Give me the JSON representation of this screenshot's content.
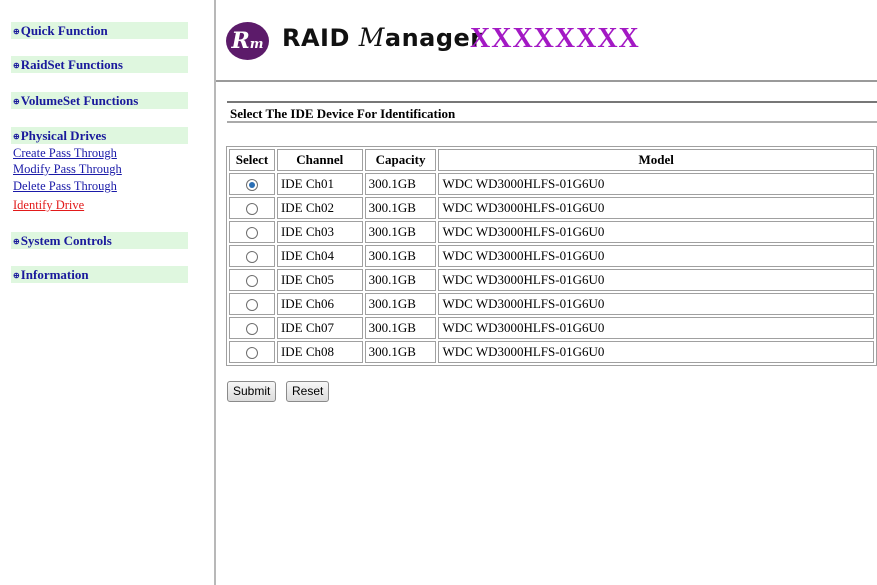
{
  "sidebar": {
    "sections": [
      {
        "label": "Quick Function"
      },
      {
        "label": "RaidSet Functions"
      },
      {
        "label": "VolumeSet Functions"
      },
      {
        "label": "Physical Drives"
      },
      {
        "label": "System Controls"
      },
      {
        "label": "Information"
      }
    ],
    "bullet": "⊕",
    "physical_links": [
      {
        "label": "Create Pass Through",
        "active": false
      },
      {
        "label": "Modify Pass Through",
        "active": false
      },
      {
        "label": "Delete Pass Through",
        "active": false
      },
      {
        "label": "Identify Drive",
        "active": true
      }
    ]
  },
  "header": {
    "logo_letters": "R",
    "logo_sub": "m",
    "logo_text_1": "RAID ",
    "logo_text_m": "M",
    "logo_text_2": "anager",
    "brand": "XXXXXXXX"
  },
  "main": {
    "section_title": "Select The IDE Device For Identification",
    "columns": [
      "Select",
      "Channel",
      "Capacity",
      "Model"
    ],
    "rows": [
      {
        "selected": true,
        "channel": "IDE Ch01",
        "capacity": "300.1GB",
        "model": "WDC WD3000HLFS-01G6U0"
      },
      {
        "selected": false,
        "channel": "IDE Ch02",
        "capacity": "300.1GB",
        "model": "WDC WD3000HLFS-01G6U0"
      },
      {
        "selected": false,
        "channel": "IDE Ch03",
        "capacity": "300.1GB",
        "model": "WDC WD3000HLFS-01G6U0"
      },
      {
        "selected": false,
        "channel": "IDE Ch04",
        "capacity": "300.1GB",
        "model": "WDC WD3000HLFS-01G6U0"
      },
      {
        "selected": false,
        "channel": "IDE Ch05",
        "capacity": "300.1GB",
        "model": "WDC WD3000HLFS-01G6U0"
      },
      {
        "selected": false,
        "channel": "IDE Ch06",
        "capacity": "300.1GB",
        "model": "WDC WD3000HLFS-01G6U0"
      },
      {
        "selected": false,
        "channel": "IDE Ch07",
        "capacity": "300.1GB",
        "model": "WDC WD3000HLFS-01G6U0"
      },
      {
        "selected": false,
        "channel": "IDE Ch08",
        "capacity": "300.1GB",
        "model": "WDC WD3000HLFS-01G6U0"
      }
    ],
    "submit_label": "Submit",
    "reset_label": "Reset"
  },
  "colors": {
    "nav_section_bg": "#dff7df",
    "nav_link": "#1a1aa8",
    "nav_active_link": "#e21a1a",
    "brand": "#a319c4",
    "logo_bg": "#5c1b6a"
  }
}
